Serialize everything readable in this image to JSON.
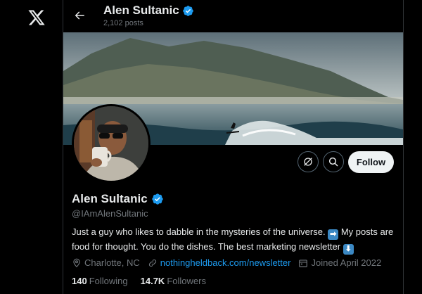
{
  "header": {
    "name": "Alen Sultanic",
    "posts_count": "2,102 posts"
  },
  "profile": {
    "name": "Alen Sultanic",
    "handle": "@IAmAlenSultanic",
    "bio_part1": "Just a guy who likes to dabble in the mysteries of the universe.",
    "bio_emoji1": "➡",
    "bio_part2": "My posts are food for thought. You do the dishes. The best marketing newsletter",
    "bio_emoji2": "⬇",
    "location": "Charlotte, NC",
    "website": "nothingheldback.com/newsletter",
    "joined": "Joined April 2022",
    "following_count": "140",
    "following_label": "Following",
    "followers_count": "14.7K",
    "followers_label": "Followers"
  },
  "actions": {
    "follow_label": "Follow"
  },
  "colors": {
    "accent": "#1d9bf0",
    "verified": "#1d9bf0",
    "follow_bg": "#eff3f4"
  },
  "icons": [
    "x-logo-icon",
    "back-arrow-icon",
    "verified-badge-icon",
    "grok-icon",
    "search-icon",
    "location-icon",
    "link-icon",
    "calendar-icon"
  ]
}
